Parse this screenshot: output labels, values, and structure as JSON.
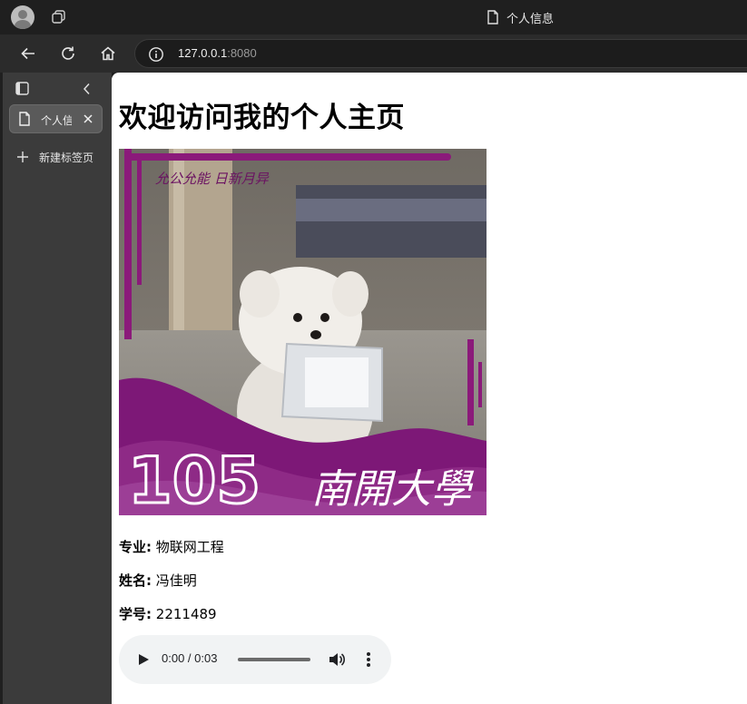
{
  "window": {
    "tab_title": "个人信息"
  },
  "toolbar": {
    "url_host": "127.0.0.1",
    "url_port": ":8080"
  },
  "sidebar": {
    "tabs": [
      {
        "label": "个人信息"
      }
    ],
    "new_tab_label": "新建标签页"
  },
  "page": {
    "heading": "欢迎访问我的个人主页",
    "image": {
      "caption_top": "允公允能 日新月异",
      "badge_number": "105",
      "university": "南開大學"
    },
    "fields": [
      {
        "label": "专业:",
        "value": "物联网工程"
      },
      {
        "label": "姓名:",
        "value": "冯佳明"
      },
      {
        "label": "学号:",
        "value": "2211489"
      }
    ],
    "audio": {
      "time": "0:00 / 0:03",
      "progress": 0
    }
  }
}
